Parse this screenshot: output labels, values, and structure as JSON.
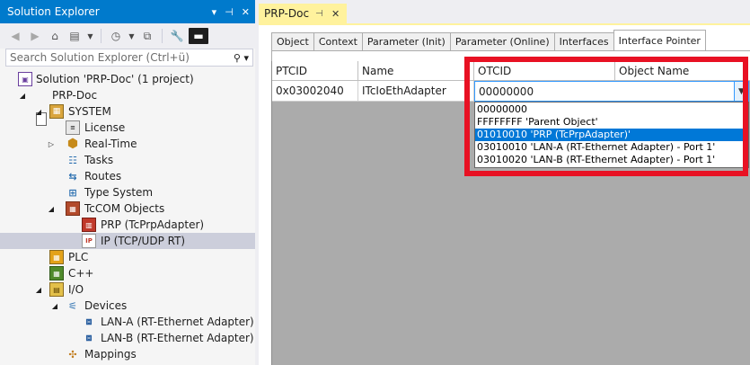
{
  "solution_explorer": {
    "title": "Solution Explorer",
    "title_controls": {
      "dropdown": "▾",
      "pin": "⊣",
      "close": "✕"
    },
    "search_placeholder": "Search Solution Explorer (Ctrl+ü)",
    "toolbar_icons": [
      "back-icon",
      "forward-icon",
      "home-icon",
      "switch-view-icon",
      "history-icon",
      "collapse-all-icon",
      "properties-icon",
      "preview-icon"
    ],
    "tree": [
      {
        "label": "Solution 'PRP-Doc' (1 project)",
        "icon": "solution-icon",
        "expander": ""
      },
      {
        "label": "PRP-Doc",
        "icon": "project-icon",
        "expander": "◢"
      },
      {
        "label": "SYSTEM",
        "icon": "system-icon",
        "expander": "◢"
      },
      {
        "label": "License",
        "icon": "license-icon",
        "expander": ""
      },
      {
        "label": "Real-Time",
        "icon": "realtime-icon",
        "expander": "▷"
      },
      {
        "label": "Tasks",
        "icon": "tasks-icon",
        "expander": ""
      },
      {
        "label": "Routes",
        "icon": "routes-icon",
        "expander": ""
      },
      {
        "label": "Type System",
        "icon": "type-system-icon",
        "expander": ""
      },
      {
        "label": "TcCOM Objects",
        "icon": "tccom-icon",
        "expander": "◢"
      },
      {
        "label": "PRP (TcPrpAdapter)",
        "icon": "prp-icon",
        "expander": ""
      },
      {
        "label": "IP (TCP/UDP RT)",
        "icon": "ip-icon",
        "expander": ""
      },
      {
        "label": "PLC",
        "icon": "plc-icon",
        "expander": ""
      },
      {
        "label": "C++",
        "icon": "cpp-icon",
        "expander": ""
      },
      {
        "label": "I/O",
        "icon": "io-icon",
        "expander": "◢"
      },
      {
        "label": "Devices",
        "icon": "devices-icon",
        "expander": "◢"
      },
      {
        "label": "LAN-A (RT-Ethernet Adapter)",
        "icon": "ethernet-adapter-icon",
        "expander": ""
      },
      {
        "label": "LAN-B (RT-Ethernet Adapter)",
        "icon": "ethernet-adapter-icon",
        "expander": ""
      },
      {
        "label": "Mappings",
        "icon": "mappings-icon",
        "expander": ""
      }
    ]
  },
  "document": {
    "tab_label": "PRP-Doc",
    "tab_pin": "⊣",
    "tab_close": "✕",
    "subtabs": [
      "Object",
      "Context",
      "Parameter (Init)",
      "Parameter (Online)",
      "Interfaces",
      "Interface Pointer"
    ],
    "active_subtab": "Interface Pointer",
    "grid": {
      "columns": [
        "PTCID",
        "Name",
        "OTCID",
        "Object Name"
      ],
      "row": {
        "ptcid": "0x03002040",
        "name": "ITcIoEthAdapter",
        "otcid": "00000000"
      },
      "dropdown_options": [
        "00000000",
        "FFFFFFFF 'Parent Object'",
        "01010010 'PRP (TcPrpAdapter)'",
        "03010010 'LAN-A (RT-Ethernet Adapter) - Port 1'",
        "03010020 'LAN-B (RT-Ethernet Adapter) - Port 1'"
      ],
      "highlighted_option": "01010010 'PRP (TcPrpAdapter)'"
    }
  },
  "colors": {
    "accent": "#007ACC",
    "tab_active": "#FFF29D",
    "selection": "#0078D7",
    "highlight_box": "#E81123",
    "grid_empty": "#ABABAB"
  }
}
